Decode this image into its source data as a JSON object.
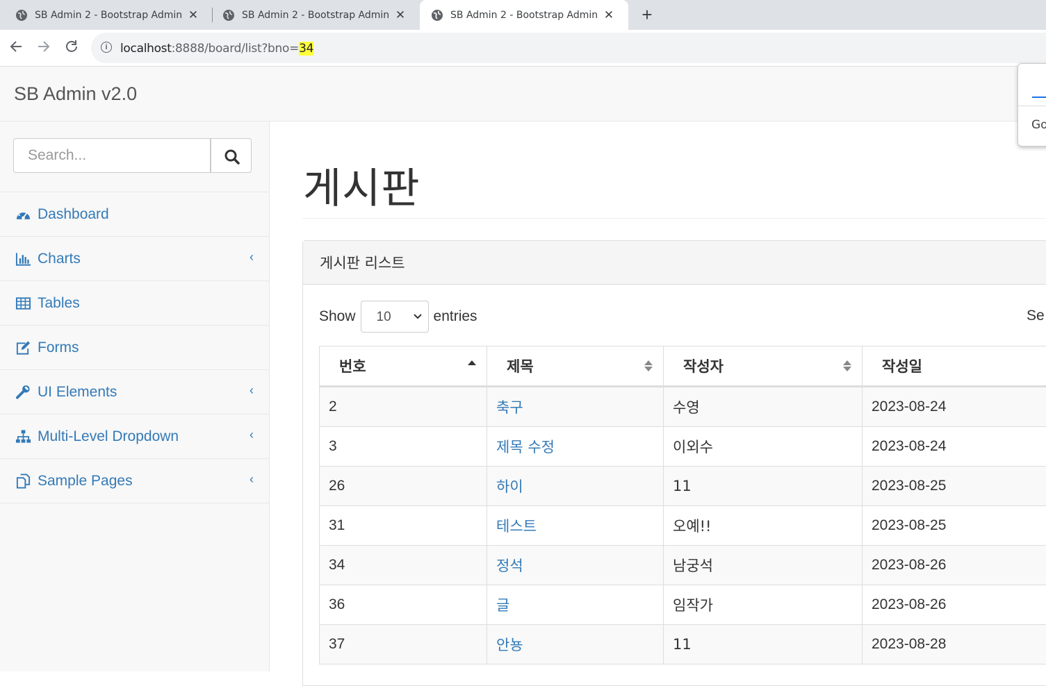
{
  "browser": {
    "tabs": [
      {
        "title": "SB Admin 2 - Bootstrap Admin",
        "active": false
      },
      {
        "title": "SB Admin 2 - Bootstrap Admin",
        "active": false
      },
      {
        "title": "SB Admin 2 - Bootstrap Admin",
        "active": true
      }
    ],
    "url_host": "localhost",
    "url_rest": ":8888/board/list?bno=",
    "url_highlight": "34",
    "popup_text": "Go"
  },
  "brand": "SB Admin v2.0",
  "search": {
    "placeholder": "Search..."
  },
  "nav": {
    "items": [
      {
        "label": "Dashboard",
        "icon": "dashboard-icon",
        "has_caret": false
      },
      {
        "label": "Charts",
        "icon": "bar-chart-icon",
        "has_caret": true
      },
      {
        "label": "Tables",
        "icon": "table-icon",
        "has_caret": false
      },
      {
        "label": "Forms",
        "icon": "edit-icon",
        "has_caret": false
      },
      {
        "label": "UI Elements",
        "icon": "wrench-icon",
        "has_caret": true
      },
      {
        "label": "Multi-Level Dropdown",
        "icon": "sitemap-icon",
        "has_caret": true
      },
      {
        "label": "Sample Pages",
        "icon": "files-icon",
        "has_caret": true
      }
    ]
  },
  "page": {
    "header": "게시판",
    "panel_title": "게시판 리스트",
    "length": {
      "show": "Show",
      "value": "10",
      "entries": "entries"
    },
    "search_label": "Se"
  },
  "table": {
    "columns": [
      "번호",
      "제목",
      "작성자",
      "작성일"
    ],
    "rows": [
      {
        "bno": "2",
        "title": "축구",
        "writer": "수영",
        "date": "2023-08-24"
      },
      {
        "bno": "3",
        "title": "제목 수정",
        "writer": "이외수",
        "date": "2023-08-24"
      },
      {
        "bno": "26",
        "title": "하이",
        "writer": "11",
        "date": "2023-08-25"
      },
      {
        "bno": "31",
        "title": "테스트",
        "writer": "오예!!",
        "date": "2023-08-25"
      },
      {
        "bno": "34",
        "title": "정석",
        "writer": "남궁석",
        "date": "2023-08-26"
      },
      {
        "bno": "36",
        "title": "글",
        "writer": "임작가",
        "date": "2023-08-26"
      },
      {
        "bno": "37",
        "title": "안뇽",
        "writer": "11",
        "date": "2023-08-28"
      }
    ]
  },
  "colors": {
    "link": "#337ab7",
    "highlight": "#ffff3a"
  }
}
